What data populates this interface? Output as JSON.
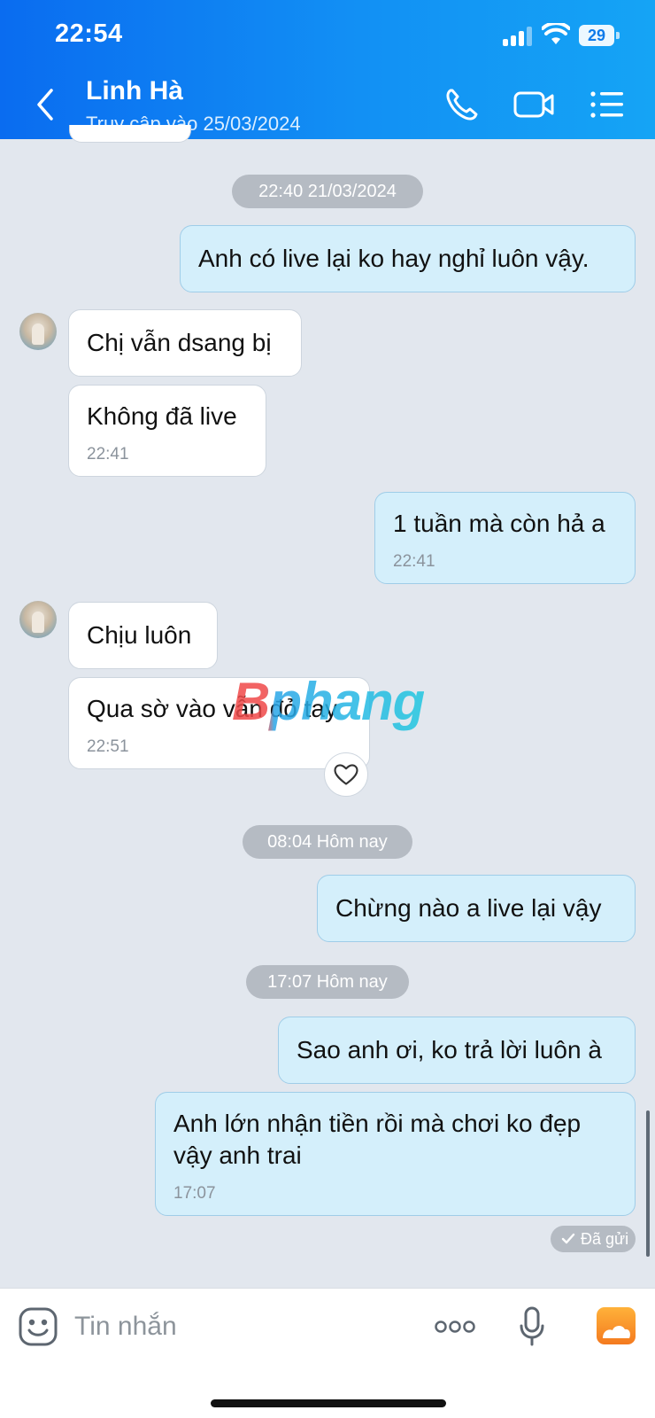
{
  "status_bar": {
    "time": "22:54",
    "battery": "29"
  },
  "header": {
    "name": "Linh Hà",
    "status": "Truy cập vào 25/03/2024",
    "icons": [
      "back-icon",
      "phone-icon",
      "video-call-icon",
      "menu-list-icon"
    ]
  },
  "chat": {
    "timestamps": [
      "22:40 21/03/2024",
      "08:04 Hôm nay",
      "17:07 Hôm nay"
    ],
    "messages": [
      {
        "dir": "out",
        "text": "Anh có live lại ko hay nghỉ luôn vậy."
      },
      {
        "dir": "in",
        "text": "Chị vẫn dsang bị"
      },
      {
        "dir": "in",
        "text": "Không đã live",
        "time": "22:41"
      },
      {
        "dir": "out",
        "text": "1 tuần mà còn hả a",
        "time": "22:41"
      },
      {
        "dir": "in",
        "text": "Chịu luôn"
      },
      {
        "dir": "in",
        "text": "Qua sờ vào vẫn đỏ tay",
        "time": "22:51"
      },
      {
        "dir": "out",
        "text": "Chừng nào a live lại vậy"
      },
      {
        "dir": "out",
        "text": "Sao anh ơi, ko trả lời luôn à"
      },
      {
        "dir": "out",
        "text_line1": "Anh lớn nhận tiền rồi mà chơi ko đẹp",
        "text_line2": "vậy anh trai",
        "time": "17:07"
      }
    ],
    "sent_status": "Đã gửi",
    "watermark": "Bphang"
  },
  "input": {
    "placeholder": "Tin nhắn"
  },
  "colors": {
    "header": "#0a6cf0",
    "bubble_out": "#d4effb",
    "bubble_in": "#ffffff",
    "background": "#e2e7ee"
  }
}
